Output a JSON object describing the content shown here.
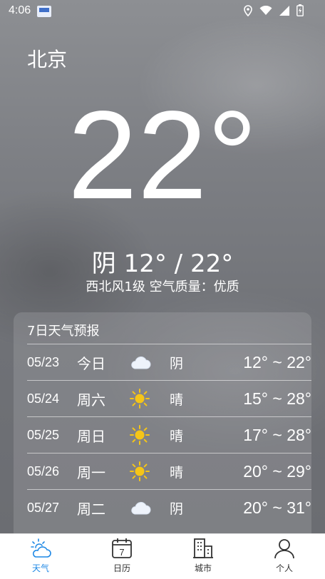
{
  "status_bar": {
    "time": "4:06"
  },
  "city": "北京",
  "current": {
    "temperature": "22°",
    "condition_range": "阴 12° / 22°",
    "details": "西北风1级  空气质量：优质"
  },
  "forecast": {
    "title": "7日天气预报",
    "days": [
      {
        "date": "05/23",
        "day": "今日",
        "icon": "cloud-icon",
        "cond": "阴",
        "range": "12° ~ 22°"
      },
      {
        "date": "05/24",
        "day": "周六",
        "icon": "sun-icon",
        "cond": "晴",
        "range": "15° ~ 28°"
      },
      {
        "date": "05/25",
        "day": "周日",
        "icon": "sun-icon",
        "cond": "晴",
        "range": "17° ~ 28°"
      },
      {
        "date": "05/26",
        "day": "周一",
        "icon": "sun-icon",
        "cond": "晴",
        "range": "20° ~ 29°"
      },
      {
        "date": "05/27",
        "day": "周二",
        "icon": "cloud-icon",
        "cond": "阴",
        "range": "20° ~ 31°"
      }
    ]
  },
  "nav": [
    {
      "label": "天气",
      "active": true
    },
    {
      "label": "日历",
      "active": false,
      "calendar_day": "7"
    },
    {
      "label": "城市",
      "active": false
    },
    {
      "label": "个人",
      "active": false
    }
  ],
  "colors": {
    "active": "#1e88e5",
    "sun": "#f5c518"
  }
}
